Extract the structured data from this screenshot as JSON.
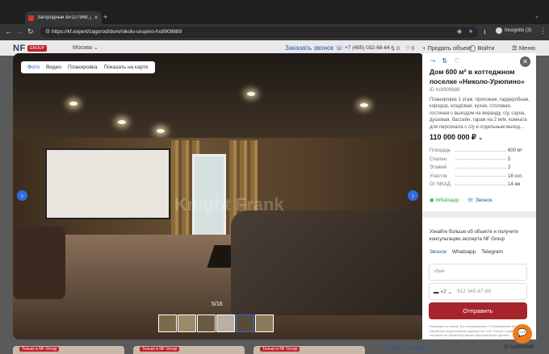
{
  "browser": {
    "tab_title": "Загородный &#127968; дом",
    "url": "https://kf.expert/zagorod/dom/nikolo-urupino-hs9909889",
    "incognito_label": "Incognito (3)"
  },
  "header": {
    "logo_text": "NF",
    "logo_badge": "GROUP",
    "city": "Москва",
    "call_label": "Заказать звонок",
    "phone": "+7 (495) 032-68-64",
    "compare_count": "0",
    "fav_count": "0",
    "sell_label": "Продать объект",
    "login_label": "Войти",
    "menu_label": "Меню"
  },
  "gallery": {
    "tabs": [
      "Фото",
      "Видео",
      "Планировка",
      "Показать на карте"
    ],
    "counter": "5/16",
    "watermark": "Knight Frank"
  },
  "listing": {
    "title": "Дом 600 м² в коттеджном поселке «Николо-Урюпино»",
    "id": "ID hs9909889",
    "description": "Планировка 1 этаж: прихожая, гардеробная, коридор, кладовая, кухня, столовая, гостиная с выходом на веранду, с/у, сауна, душевая, бассейн, гараж на 2 м/м, комната для персонала с с/у и отдельным выход...",
    "price": "110 000 000 ₽",
    "params": [
      {
        "key": "Площадь",
        "value": "600 м²"
      },
      {
        "key": "Спален",
        "value": "5"
      },
      {
        "key": "Этажей",
        "value": "2"
      },
      {
        "key": "Участок",
        "value": "18 сот."
      },
      {
        "key": "От МКАД",
        "value": "14 км"
      }
    ],
    "whatsapp_label": "Whatsapp",
    "call_label": "Звонок"
  },
  "form": {
    "intro": "Узнайте больше об объекте и получите консультацию эксперта NF Group",
    "tabs": [
      "Звонок",
      "Whatsapp",
      "Telegram"
    ],
    "name_placeholder": "Имя",
    "country_code": "+7",
    "phone_placeholder": "912 345-67-89",
    "submit_label": "Отправить",
    "legal": "Нажимая на кнопку, Вы соглашаетесь с «Положением об обработке персональных данных АО «NF Group» и даёте согласие на обработку Ваших персональных данных"
  },
  "bottom": {
    "cards_badge": "Только в NF Group",
    "link": "Следить за ценой",
    "id": "ID hs9909889"
  }
}
